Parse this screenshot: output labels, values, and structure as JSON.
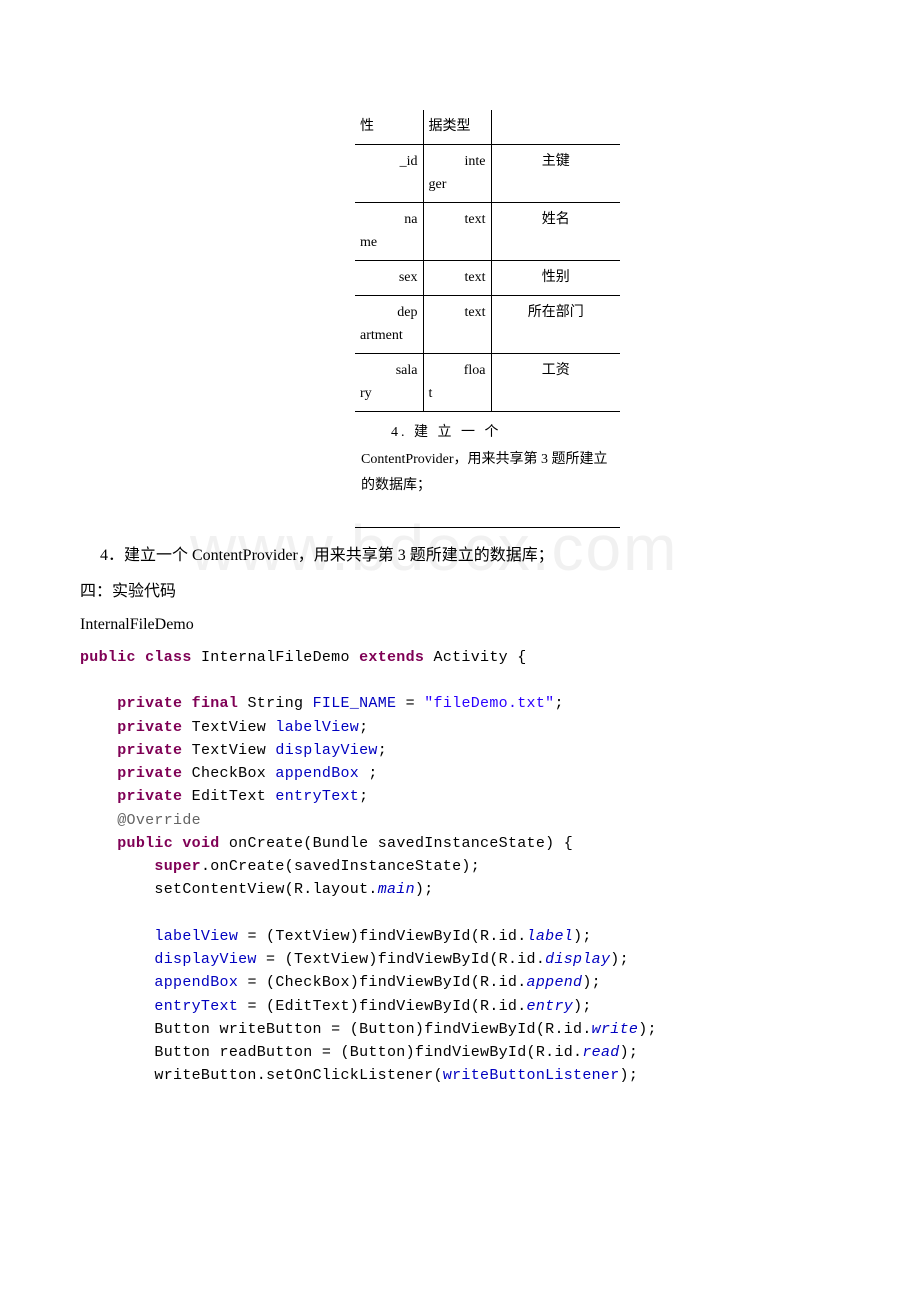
{
  "table": {
    "header": {
      "c1": "性",
      "c2": "据类型",
      "c3": ""
    },
    "rows": [
      {
        "c1a": "_id",
        "c1b": "",
        "c2a": "inte",
        "c2b": "ger",
        "c3": "主键"
      },
      {
        "c1a": "na",
        "c1b": "me",
        "c2a": "text",
        "c2b": "",
        "c3": "姓名"
      },
      {
        "c1a": "sex",
        "c1b": "",
        "c2a": "text",
        "c2b": "",
        "c3": "性别",
        "single": true
      },
      {
        "c1a": "dep",
        "c1b": "artment",
        "c2a": "text",
        "c2b": "",
        "c3": "所在部门"
      },
      {
        "c1a": "sala",
        "c1b": "ry",
        "c2a": "floa",
        "c2b": "t",
        "c3": "工资"
      }
    ],
    "note_first": "4.   建  立  一  个",
    "note_rest": "ContentProvider，用来共享第 3 题所建立的数据库；"
  },
  "line4": "4．建立一个 ContentProvider，用来共享第 3 题所建立的数据库；",
  "section": "四：实验代码",
  "classLabel": "InternalFileDemo",
  "watermark": "www.bdocx.com",
  "code": {
    "kw": {
      "public": "public",
      "class": "class",
      "extends": "extends",
      "private": "private",
      "final": "final",
      "void": "void",
      "super": "super"
    },
    "name": {
      "cls": "InternalFileDemo",
      "act": "Activity",
      "str": "String",
      "tv": "TextView",
      "cb": "CheckBox",
      "et": "EditText",
      "bt": "Button",
      "bu": "Bundle",
      "rid": "R.id.",
      "rlay": "R.layout."
    },
    "field": {
      "FILE_NAME": "FILE_NAME",
      "label": "labelView",
      "display": "displayView",
      "append": "appendBox",
      "entry": "entryText",
      "fileDemo": "\"fileDemo.txt\"",
      "writeL": "writeButtonListener"
    },
    "id": {
      "main": "main",
      "label": "label",
      "display": "display",
      "append": "append",
      "entry": "entry",
      "write": "write",
      "read": "read"
    },
    "ann": "@Override",
    "fn": {
      "onCreate": "onCreate",
      "setCV": "setContentView",
      "fvbi": "findViewById",
      "socl": "setOnClickListener"
    },
    "var": {
      "wb": "writeButton",
      "rb": "readButton",
      "sis": "savedInstanceState"
    }
  }
}
